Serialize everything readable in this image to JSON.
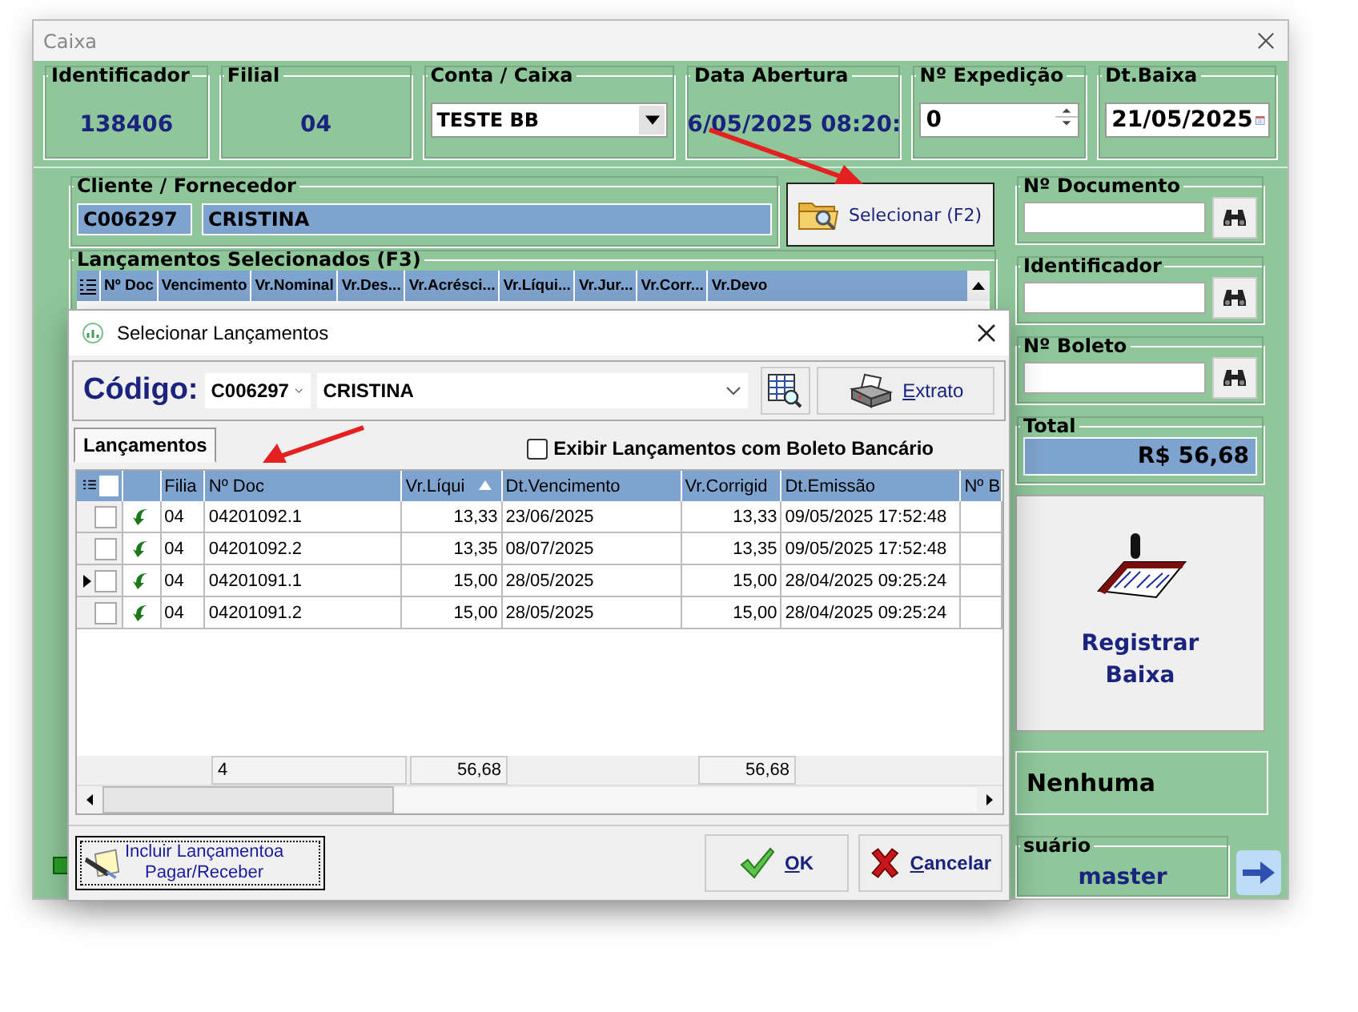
{
  "window": {
    "title": "Caixa"
  },
  "header_fields": [
    {
      "kind": "display",
      "label": "Identificador",
      "value": "138406"
    },
    {
      "kind": "display",
      "label": "Filial",
      "value": "04"
    },
    {
      "kind": "combo",
      "label": "Conta / Caixa",
      "value": "TESTE BB"
    },
    {
      "kind": "display",
      "label": "Data Abertura",
      "value": "6/05/2025 08:20:"
    },
    {
      "kind": "spin",
      "label": "Nº Expedição",
      "value": "0"
    },
    {
      "kind": "date",
      "label": "Dt.Baixa",
      "value": "21/05/2025"
    }
  ],
  "client": {
    "label": "Cliente / Fornecedor",
    "code": "C006297",
    "name": "CRISTINA"
  },
  "select_button": "Selecionar (F2)",
  "selected_grid": {
    "title": "Lançamentos Selecionados (F3)",
    "columns": [
      "Nº Doc",
      "Vencimento",
      "Vr.Nominal",
      "Vr.Des...",
      "Vr.Acrésci...",
      "Vr.Líqui...",
      "Vr.Jur...",
      "Vr.Corr...",
      "Vr.Devo"
    ]
  },
  "search_fields": [
    {
      "label": "Nº Documento"
    },
    {
      "label": "Identificador"
    },
    {
      "label": "Nº Boleto"
    }
  ],
  "total": {
    "label": "Total",
    "value": "R$ 56,68"
  },
  "register_button": "Registrar Baixa",
  "status": "Nenhuma",
  "user": {
    "label": "suário",
    "value": "master"
  },
  "dialog": {
    "title": "Selecionar Lançamentos",
    "code_label": "Código:",
    "code": "C006297",
    "name": "CRISTINA",
    "extrato_button": "Extrato",
    "tabs": [
      {
        "label": "Lançamentos",
        "selected": true
      }
    ],
    "boleto_checkbox": {
      "label": "Exibir Lançamentos com Boleto Bancário",
      "checked": false
    },
    "select_all": {
      "checked": false
    },
    "columns": [
      {
        "label": "Filia",
        "sorted": false
      },
      {
        "label": "Nº Doc",
        "sorted": false
      },
      {
        "label": "Vr.Líqui",
        "sorted": true
      },
      {
        "label": "Dt.Vencimento",
        "sorted": false
      },
      {
        "label": "Vr.Corrigid",
        "sorted": false
      },
      {
        "label": "Dt.Emissão",
        "sorted": false
      },
      {
        "label": "Nº B",
        "sorted": false
      }
    ],
    "rows": [
      {
        "current": false,
        "checked": false,
        "filial": "04",
        "doc": "04201092.1",
        "vr_liquido": "13,33",
        "vencimento": "23/06/2025",
        "vr_corrigido": "13,33",
        "emissao": "09/05/2025 17:52:48"
      },
      {
        "current": false,
        "checked": false,
        "filial": "04",
        "doc": "04201092.2",
        "vr_liquido": "13,35",
        "vencimento": "08/07/2025",
        "vr_corrigido": "13,35",
        "emissao": "09/05/2025 17:52:48"
      },
      {
        "current": true,
        "checked": false,
        "filial": "04",
        "doc": "04201091.1",
        "vr_liquido": "15,00",
        "vencimento": "28/05/2025",
        "vr_corrigido": "15,00",
        "emissao": "28/04/2025 09:25:24"
      },
      {
        "current": false,
        "checked": false,
        "filial": "04",
        "doc": "04201091.2",
        "vr_liquido": "15,00",
        "vencimento": "28/05/2025",
        "vr_corrigido": "15,00",
        "emissao": "28/04/2025 09:25:24"
      }
    ],
    "totals": {
      "count": "4",
      "vr_liquido": "56,68",
      "vr_corrigido": "56,68"
    },
    "include_button": [
      "Incluir Lançamentoa",
      "Pagar/Receber"
    ],
    "ok_button": "OK",
    "cancel_button": "Cancelar"
  }
}
